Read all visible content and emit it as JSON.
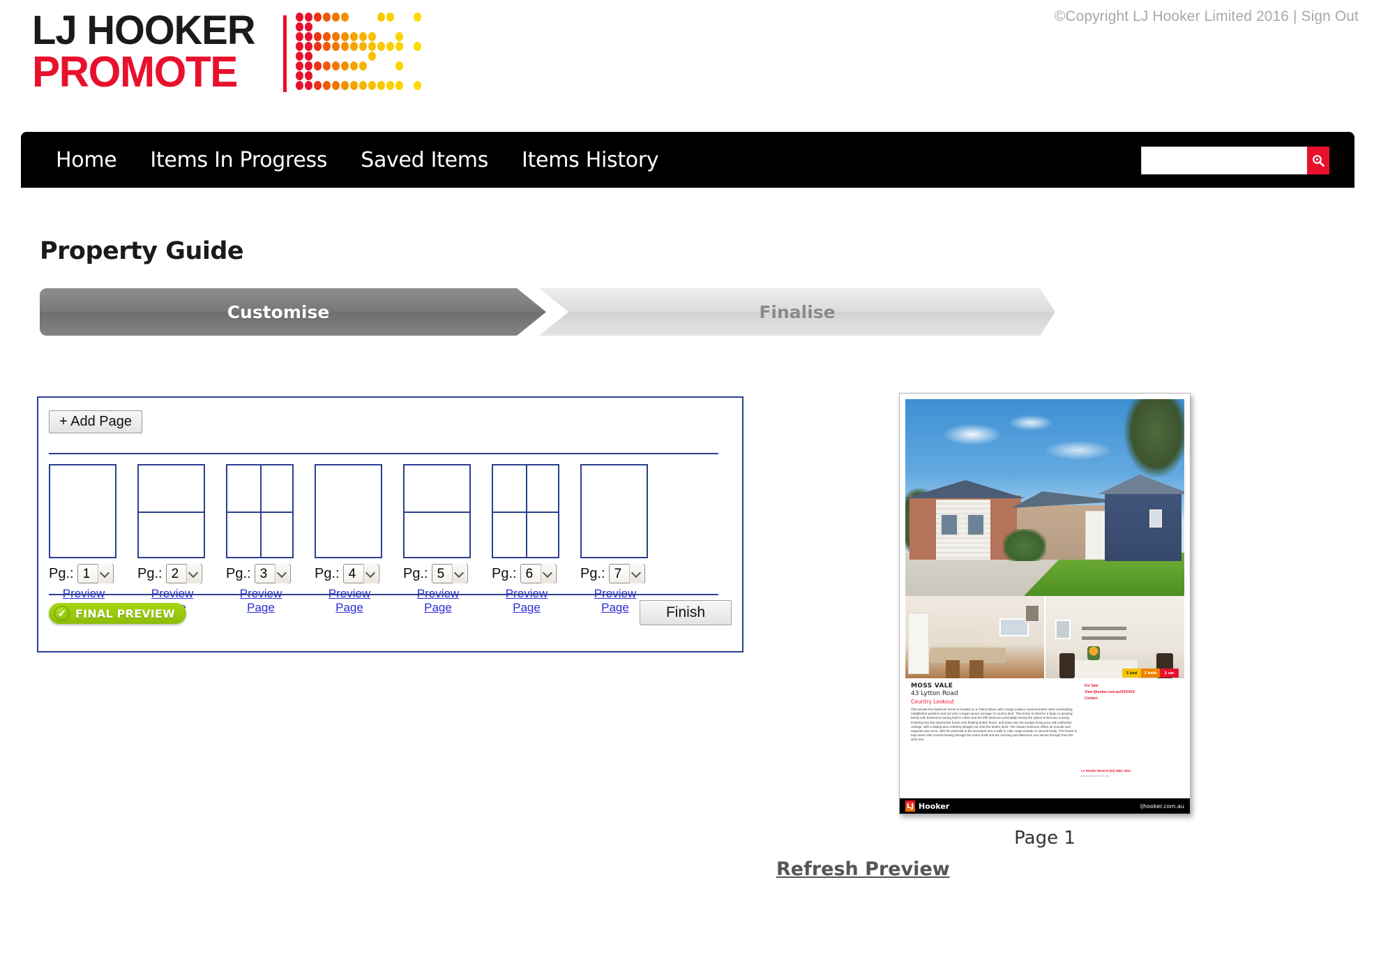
{
  "header": {
    "copyright": "©Copyright LJ Hooker Limited 2016 | Sign Out",
    "logo": {
      "line1": "LJ HOOKER",
      "line2": "PROMOTE",
      "black": "#1a1a1a",
      "red": "#e8112d"
    }
  },
  "nav": {
    "items": [
      {
        "label": "Home"
      },
      {
        "label": "Items In Progress"
      },
      {
        "label": "Saved Items"
      },
      {
        "label": "Items History"
      }
    ],
    "search": {
      "value": "",
      "placeholder": "",
      "icon": "search-icon"
    }
  },
  "page": {
    "title": "Property Guide"
  },
  "steps": [
    {
      "label": "Customise",
      "state": "active"
    },
    {
      "label": "Finalise",
      "state": "inactive"
    }
  ],
  "pages_panel": {
    "add_page_label": "+ Add Page",
    "pg_label": "Pg.:",
    "preview_page_label": "Preview Page",
    "final_preview_label": "FINAL PREVIEW",
    "final_preview_check": "✓",
    "finish_label": "Finish",
    "border_color": "#2a3f8f",
    "thumbnails": [
      {
        "page": "1",
        "layout": "single"
      },
      {
        "page": "2",
        "layout": "two-rows"
      },
      {
        "page": "3",
        "layout": "quad"
      },
      {
        "page": "4",
        "layout": "single"
      },
      {
        "page": "5",
        "layout": "two-rows"
      },
      {
        "page": "6",
        "layout": "quad"
      },
      {
        "page": "7",
        "layout": "single"
      }
    ]
  },
  "preview": {
    "page_label": "Page 1",
    "refresh_label": "Refresh Preview",
    "flyer": {
      "suburb": "MOSS VALE",
      "street": "43 Lytton Road",
      "headline": "Country Lookout",
      "blurb": "This private five bedroom home is located on a 795m2 block with a large outdoor covered timber deck overlooking established gardens and out onto a large vacant acreage of country land. This home is ideal for a large or growing family with bedrooms having built in robes and the fifth bedroom potentially having the option to become a study. Entering into this impressive home onto floating timber floors, and down into the sunken living area with cathedral ceilings, with a sliding door entering straight out onto the timber deck. The master bedroom offers an ensuite and separate spa room, with the potential to be renovated into a walk in robe, large ensuite or second study. The house is kept warm with central heating through the entire build and the morning and afternoon sun shines through from the deck into",
      "badges": [
        {
          "text": "5 bed",
          "color": "#f5c400"
        },
        {
          "text": "2 bath",
          "color": "#f08200"
        },
        {
          "text": "2 car",
          "color": "#e8112d"
        }
      ],
      "side": {
        "for_sale": "For Sale",
        "view": "View ljhooker.com.au/XXXXXX",
        "contact": "Contact"
      },
      "agent": {
        "name": "LJ Hooker Bowral (02) 4861 2811",
        "sub": "ljhookerbowral.com.au"
      },
      "footer": {
        "mark": "LJ",
        "brand": "Hooker",
        "url": "ljhooker.com.au"
      }
    }
  }
}
